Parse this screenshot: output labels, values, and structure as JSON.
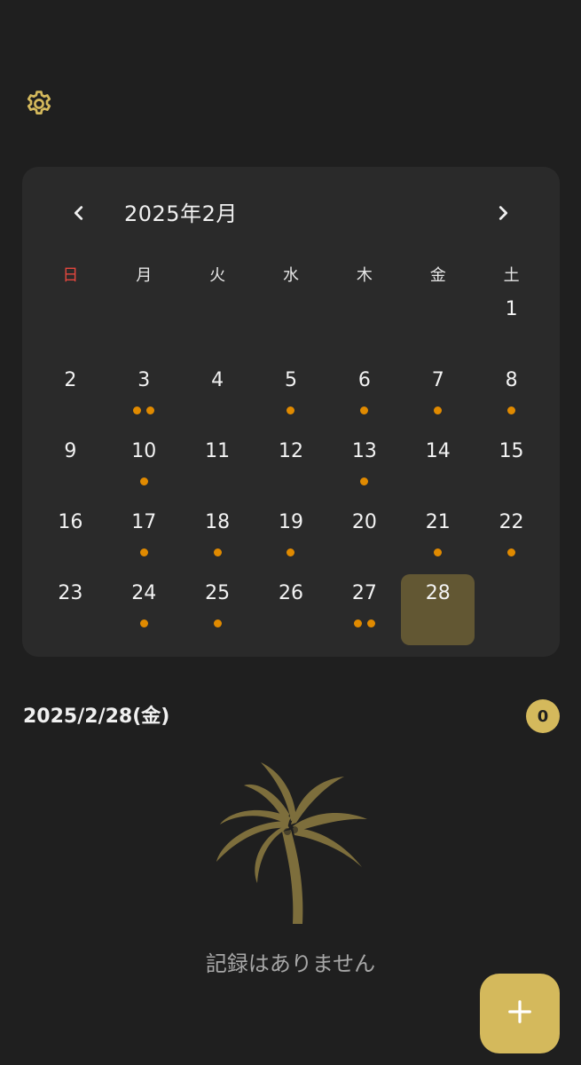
{
  "header": {
    "settings_icon": "gear-icon"
  },
  "calendar": {
    "title": "2025年2月",
    "prev_icon": "chevron-left-icon",
    "next_icon": "chevron-right-icon",
    "weekdays": [
      "日",
      "月",
      "火",
      "水",
      "木",
      "金",
      "土"
    ],
    "leading_blanks": 6,
    "days": [
      {
        "label": "1",
        "dots": 0
      },
      {
        "label": "2",
        "dots": 0
      },
      {
        "label": "3",
        "dots": 2
      },
      {
        "label": "4",
        "dots": 0
      },
      {
        "label": "5",
        "dots": 1
      },
      {
        "label": "6",
        "dots": 1
      },
      {
        "label": "7",
        "dots": 1
      },
      {
        "label": "8",
        "dots": 1
      },
      {
        "label": "9",
        "dots": 0
      },
      {
        "label": "10",
        "dots": 1
      },
      {
        "label": "11",
        "dots": 0
      },
      {
        "label": "12",
        "dots": 0
      },
      {
        "label": "13",
        "dots": 1
      },
      {
        "label": "14",
        "dots": 0
      },
      {
        "label": "15",
        "dots": 0
      },
      {
        "label": "16",
        "dots": 0
      },
      {
        "label": "17",
        "dots": 1
      },
      {
        "label": "18",
        "dots": 1
      },
      {
        "label": "19",
        "dots": 1
      },
      {
        "label": "20",
        "dots": 0
      },
      {
        "label": "21",
        "dots": 1
      },
      {
        "label": "22",
        "dots": 1
      },
      {
        "label": "23",
        "dots": 0
      },
      {
        "label": "24",
        "dots": 1
      },
      {
        "label": "25",
        "dots": 1
      },
      {
        "label": "26",
        "dots": 0
      },
      {
        "label": "27",
        "dots": 2
      },
      {
        "label": "28",
        "dots": 0,
        "selected": true
      }
    ]
  },
  "day_panel": {
    "date": "2025/2/28(金)",
    "count": "0",
    "empty_icon": "palm-tree-icon",
    "empty_message": "記録はありません"
  },
  "fab": {
    "icon": "plus-icon"
  },
  "colors": {
    "background": "#1f1f1f",
    "card": "#2a2a2a",
    "accent": "#d4b95c",
    "dot": "#e08a00",
    "sunday": "#e5473e",
    "selected": "#625733"
  }
}
